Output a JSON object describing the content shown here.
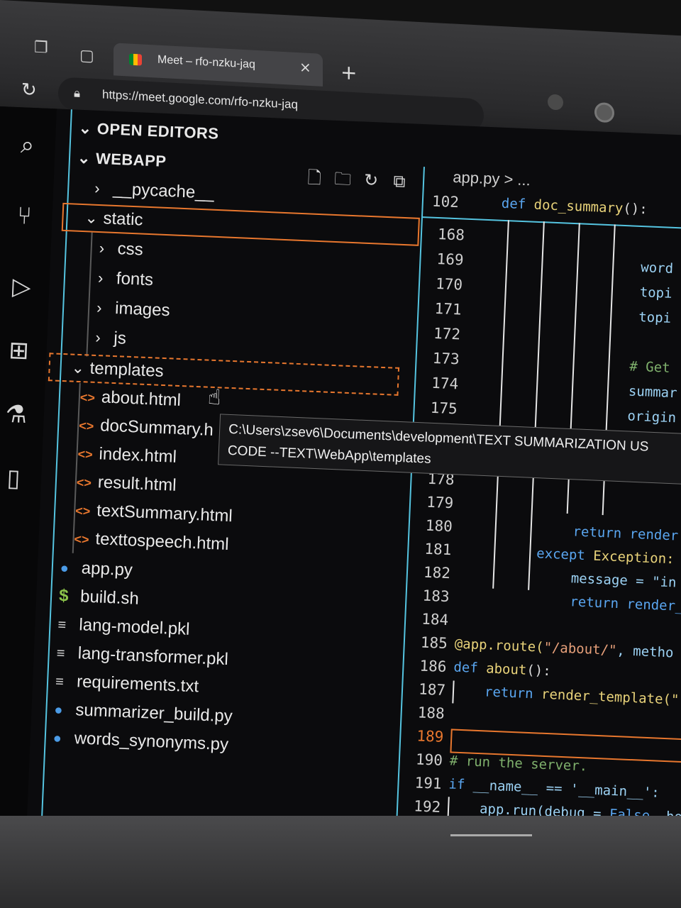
{
  "browser": {
    "tab_title": "Meet – rfo-nzku-jaq",
    "tab_close": "×",
    "new_tab": "+",
    "url": "https://meet.google.com/rfo-nzku-jaq"
  },
  "explorer": {
    "open_editors": "OPEN EDITORS",
    "workspace": "WEBAPP",
    "items": [
      {
        "label": "__pycache__"
      },
      {
        "label": "static"
      },
      {
        "label": "css"
      },
      {
        "label": "fonts"
      },
      {
        "label": "images"
      },
      {
        "label": "js"
      },
      {
        "label": "templates"
      },
      {
        "label": "about.html"
      },
      {
        "label": "docSummary.h"
      },
      {
        "label": "index.html"
      },
      {
        "label": "result.html"
      },
      {
        "label": "textSummary.html"
      },
      {
        "label": "texttospeech.html"
      },
      {
        "label": "app.py"
      },
      {
        "label": "build.sh"
      },
      {
        "label": "lang-model.pkl"
      },
      {
        "label": "lang-transformer.pkl"
      },
      {
        "label": "requirements.txt"
      },
      {
        "label": "summarizer_build.py"
      },
      {
        "label": "words_synonyms.py"
      }
    ]
  },
  "tooltip": {
    "line1": "C:\\Users\\zsev6\\Documents\\development\\TEXT SUMMARIZATION US",
    "line2": "CODE --TEXT\\WebApp\\templates"
  },
  "editor": {
    "breadcrumb": "app.py > ...",
    "sticky_line_no": "102",
    "sticky_code": "def doc_summary():",
    "line_numbers": [
      "168",
      "169",
      "170",
      "171",
      "172",
      "173",
      "174",
      "175",
      "178",
      "179",
      "180",
      "181",
      "182",
      "183",
      "184",
      "185",
      "186",
      "187",
      "188",
      "189",
      "190",
      "191",
      "192"
    ],
    "code": {
      "l169": "word",
      "l170": "topi",
      "l171": "topi",
      "l173": "# Get",
      "l174": "summar",
      "l175": "origin",
      "l180": "return render",
      "l181a": "except",
      "l181b": "Exception:",
      "l182": "message = \"in",
      "l183": "return render_",
      "l185a": "@app.route(",
      "l185b": "\"/about/\"",
      "l185c": ", metho",
      "l186a": "def",
      "l186b": "about",
      "l186c": "():",
      "l187a": "return",
      "l187b": "render_template(\"",
      "l190": "# run the server.",
      "l191a": "if",
      "l191b": "__name__ == '__main__':",
      "l192a": "app.run(debug = ",
      "l192b": "False",
      "l192c": ", hos"
    }
  },
  "colors": {
    "accent_orange": "#e8772e",
    "accent_cyan": "#55c4e0",
    "keyword_blue": "#5aa6f0",
    "function_yellow": "#e9d37a"
  }
}
